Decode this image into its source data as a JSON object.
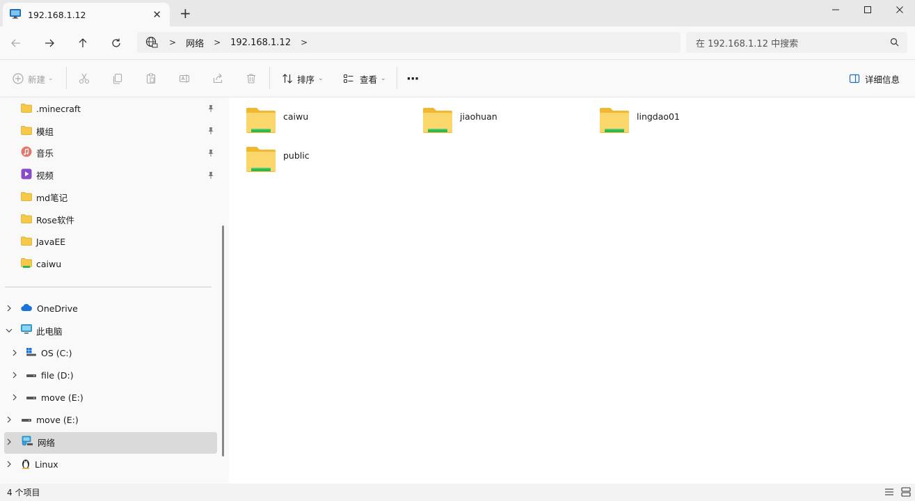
{
  "window": {
    "tab_title": "192.168.1.12",
    "new_tab": "+",
    "close_tab": "✕"
  },
  "address": {
    "breadcrumbs": [
      "网络",
      "192.168.1.12"
    ],
    "search_placeholder": "在 192.168.1.12 中搜索"
  },
  "toolbar": {
    "new_label": "新建",
    "sort_label": "排序",
    "view_label": "查看",
    "more_label": "···",
    "details_label": "详细信息"
  },
  "sidebar": {
    "quick_access": [
      {
        "label": ".minecraft",
        "icon": "folder-icon",
        "pinned": true
      },
      {
        "label": "模组",
        "icon": "folder-icon",
        "pinned": true
      },
      {
        "label": "音乐",
        "icon": "music-icon",
        "pinned": true
      },
      {
        "label": "视频",
        "icon": "video-icon",
        "pinned": true
      },
      {
        "label": "md笔记",
        "icon": "folder-icon",
        "pinned": false
      },
      {
        "label": "Rose软件",
        "icon": "folder-icon",
        "pinned": false
      },
      {
        "label": "JavaEE",
        "icon": "folder-icon",
        "pinned": false
      },
      {
        "label": "caiwu",
        "icon": "network-folder-icon",
        "pinned": false
      }
    ],
    "tree": [
      {
        "label": "OneDrive",
        "icon": "cloud-icon",
        "expanded": false
      },
      {
        "label": "此电脑",
        "icon": "computer-icon",
        "expanded": true
      },
      {
        "label": "OS (C:)",
        "icon": "windows-drive-icon",
        "expanded": false
      },
      {
        "label": "file (D:)",
        "icon": "drive-icon",
        "expanded": false
      },
      {
        "label": "move (E:)",
        "icon": "drive-icon",
        "expanded": false
      },
      {
        "label": "move (E:)",
        "icon": "drive-icon",
        "expanded": false
      },
      {
        "label": "网络",
        "icon": "network-icon",
        "expanded": false,
        "selected": true
      },
      {
        "label": "Linux",
        "icon": "linux-icon",
        "expanded": false
      }
    ]
  },
  "content": {
    "folders": [
      {
        "name": "caiwu"
      },
      {
        "name": "jiaohuan"
      },
      {
        "name": "lingdao01"
      },
      {
        "name": "public"
      }
    ]
  },
  "status": {
    "item_count": "4 个项目"
  },
  "colors": {
    "folder_yellow": "#f7c948",
    "share_green": "#2db84d",
    "selected_bg": "#dadada"
  }
}
